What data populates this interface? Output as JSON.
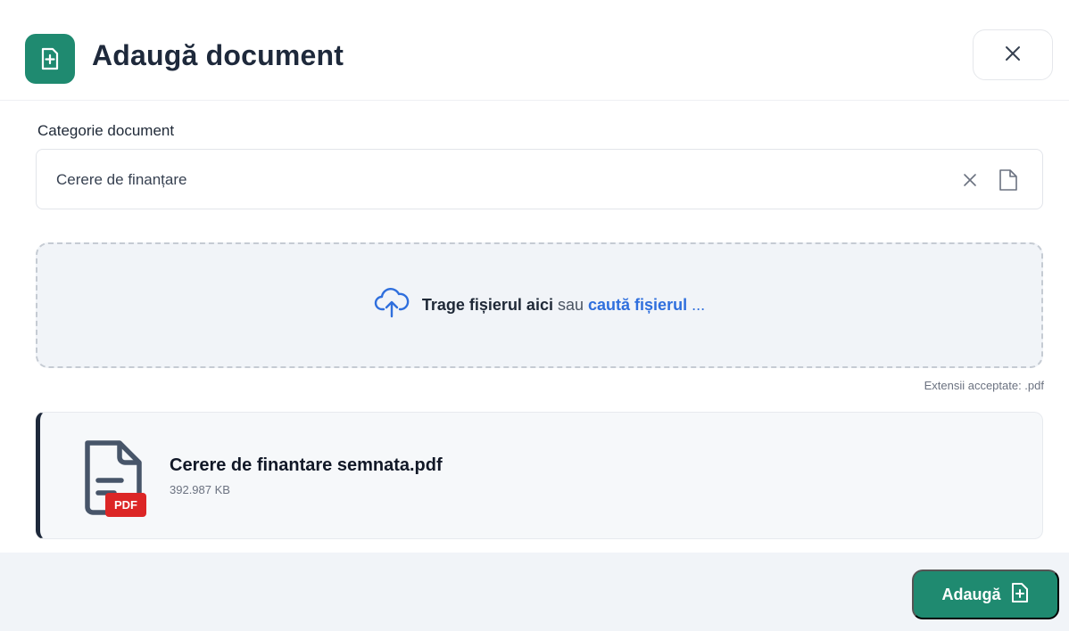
{
  "dialog": {
    "title": "Adaugă document",
    "icon": "file-plus-icon",
    "close_icon": "close-icon"
  },
  "category_field": {
    "label": "Categorie document",
    "value": "Cerere de finanțare",
    "clear_icon": "close-icon",
    "trailing_icon": "document-icon"
  },
  "dropzone": {
    "icon": "cloud-upload-icon",
    "text_strong": "Trage fișierul aici",
    "text_or": "sau",
    "link_text": "caută fișierul",
    "ellipsis": "...",
    "note": "Extensii acceptate: .pdf"
  },
  "file": {
    "name": "Cerere de finantare semnata.pdf",
    "size": "392.987 KB",
    "badge": "PDF",
    "icon": "file-text-icon"
  },
  "footer": {
    "add_label": "Adaugă",
    "add_icon": "file-plus-icon"
  },
  "colors": {
    "accent": "#1f8a70",
    "link": "#2f6fdd",
    "pdf_badge": "#dc2626",
    "dropzone_bg": "#f1f4f8"
  }
}
